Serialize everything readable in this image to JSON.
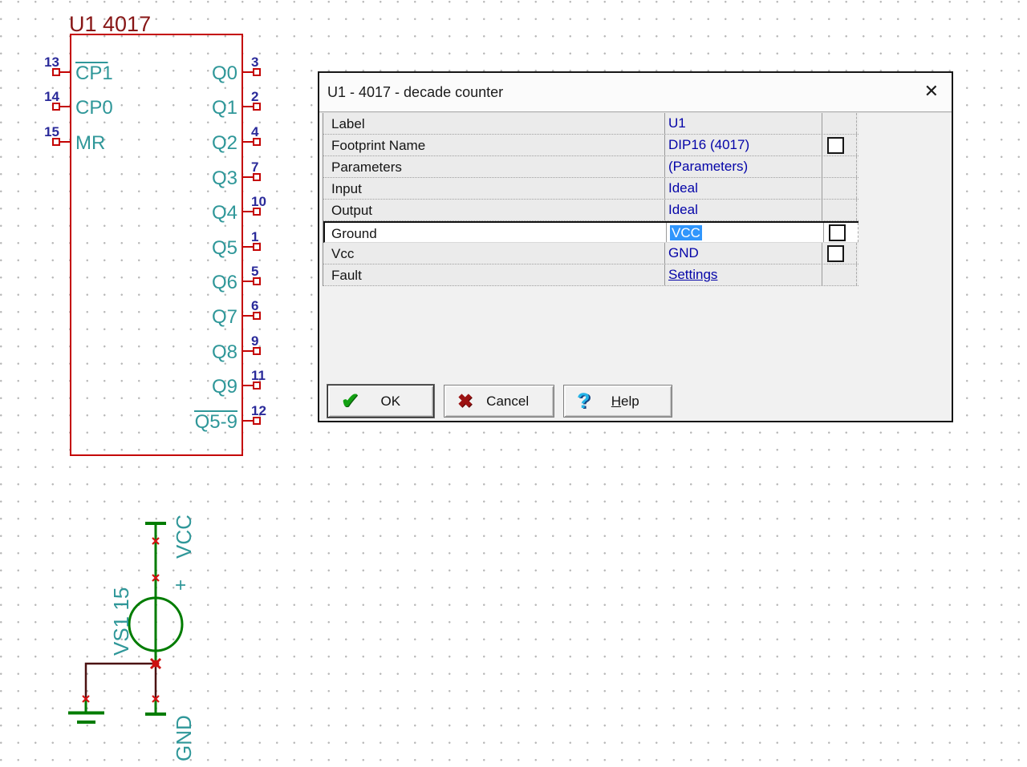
{
  "schematic": {
    "ic": {
      "title": "U1 4017",
      "left_pins": [
        {
          "number": "13",
          "label": "CP1",
          "overline": true
        },
        {
          "number": "14",
          "label": "CP0",
          "overline": false
        },
        {
          "number": "15",
          "label": "MR",
          "overline": false
        }
      ],
      "right_pins": [
        {
          "number": "3",
          "label": "Q0",
          "overline": false
        },
        {
          "number": "2",
          "label": "Q1",
          "overline": false
        },
        {
          "number": "4",
          "label": "Q2",
          "overline": false
        },
        {
          "number": "7",
          "label": "Q3",
          "overline": false
        },
        {
          "number": "10",
          "label": "Q4",
          "overline": false
        },
        {
          "number": "1",
          "label": "Q5",
          "overline": false
        },
        {
          "number": "5",
          "label": "Q6",
          "overline": false
        },
        {
          "number": "6",
          "label": "Q7",
          "overline": false
        },
        {
          "number": "9",
          "label": "Q8",
          "overline": false
        },
        {
          "number": "11",
          "label": "Q9",
          "overline": false
        },
        {
          "number": "12",
          "label": "Q5-9",
          "overline": true
        }
      ]
    },
    "source": {
      "designator": "VS1 15",
      "polarity": "+",
      "top_rail": "VCC",
      "bottom_rail": "GND"
    },
    "colors": {
      "symbol_red": "#c40404",
      "title_red": "#871616",
      "pin_teal": "#2f9799",
      "pin_number_navy": "#2a2a9a",
      "component_green": "#007c00",
      "wire_dark": "#4c1212",
      "node_red": "#d51212"
    }
  },
  "dialog": {
    "title": "U1 - 4017 - decade counter",
    "close_icon": "✕",
    "table": {
      "rows": [
        {
          "label": "Label",
          "value": "U1",
          "checkbox": false,
          "selected": false,
          "link": false
        },
        {
          "label": "Footprint Name",
          "value": "DIP16 (4017)",
          "checkbox": true,
          "selected": false,
          "link": false
        },
        {
          "label": "Parameters",
          "value": "(Parameters)",
          "checkbox": false,
          "selected": false,
          "link": false
        },
        {
          "label": "Input",
          "value": "Ideal",
          "checkbox": false,
          "selected": false,
          "link": false
        },
        {
          "label": "Output",
          "value": "Ideal",
          "checkbox": false,
          "selected": false,
          "link": false
        },
        {
          "label": "Ground",
          "value": "VCC",
          "checkbox": true,
          "selected": true,
          "link": false
        },
        {
          "label": "Vcc",
          "value": "GND",
          "checkbox": true,
          "selected": false,
          "link": false
        },
        {
          "label": "Fault",
          "value": "Settings",
          "checkbox": false,
          "selected": false,
          "link": true
        }
      ]
    },
    "icons": {
      "check": "✔",
      "cross": "✖",
      "question": "?"
    },
    "buttons": [
      {
        "label": "OK"
      },
      {
        "label": "Cancel"
      },
      {
        "label_accel": "H",
        "label_rest": "elp"
      }
    ],
    "colors": {
      "value_blue": "#0404a8",
      "selection_blue": "#3096fc"
    }
  }
}
